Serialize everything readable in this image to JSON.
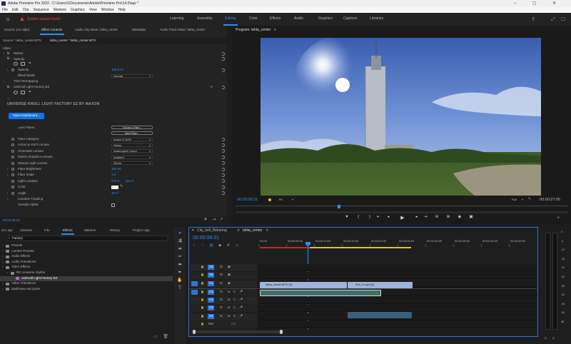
{
  "window": {
    "title": "Adobe Premiere Pro 2022 - C:\\Users\\1\\Documents\\Adobe\\Premiere Pro\\14.0\\aqv *",
    "minimize": "–",
    "maximize": "▢",
    "close": "✕"
  },
  "menu": [
    "File",
    "Edit",
    "Clip",
    "Sequence",
    "Markers",
    "Graphics",
    "View",
    "Window",
    "Help"
  ],
  "topbar": {
    "issues": "System issues found",
    "workspaces": [
      "Learning",
      "Assembly",
      "Editing",
      "Color",
      "Effects",
      "Audio",
      "Graphics",
      "Captions",
      "Libraries"
    ],
    "active": "Editing"
  },
  "source_tabs": [
    "Source: (no clips)",
    "Effect Controls",
    "Audio Clip Mixer: lahta_center",
    "Metadata",
    "Audio Track Mixer: lahta_center"
  ],
  "ec": {
    "source_label": "Source * lahta_center.MTS",
    "seq_label": "lahta_center * lahta_center.MTS",
    "video": "Video",
    "motion": "Motion",
    "opacity_group": "Opacity",
    "opacity_label": "Opacity",
    "opacity_value": "100.0 %",
    "blend_label": "Blend Mode",
    "blend_value": "Normal",
    "time_remap": "Time Remapping",
    "unknoll": "uniKnoll Light Factory EZ",
    "brand": "UNIVERSE KNOLL LIGHT FACTORY EZ BY MAXON",
    "dashboard": "Open Dashboard...",
    "lens_flares": "Lens Flares",
    "choose_flare": "Choose a Flare...",
    "save_flare": "Save Flare...",
    "params": [
      {
        "label": "Flare Category",
        "value": "Action & SciFi"
      },
      {
        "label": "Action & SciFi Lenses",
        "value": "Helios"
      },
      {
        "label": "Cinematic Lenses",
        "value": "Anamorphic Zoom"
      },
      {
        "label": "Motion Graphics Lenses",
        "value": "Ambient"
      },
      {
        "label": "Natural Light Lenses",
        "value": "35mm"
      }
    ],
    "brightness_label": "Flare Brightness",
    "brightness_value": "100.00",
    "scale_label": "Flare Scale",
    "scale_value": "1.0",
    "location_label": "Light Location",
    "location_x": "579.0",
    "location_y": "324.0",
    "color_label": "Color",
    "angle_label": "Angle",
    "angle_value": "40.0 °",
    "loc_tracking": "Location Tracking",
    "xrender": "Xrender Alpha",
    "timecode": "00:00:08:31"
  },
  "program": {
    "title": "Program: lahta_center",
    "timecode": "00:00:08:31",
    "fit": "Fit",
    "quality": "Full",
    "duration": "00:00:27:06"
  },
  "project": {
    "tabs": [
      "ect: aqv",
      "Libraries",
      "Info",
      "Effects",
      "Markers",
      "History",
      "Project: aqv"
    ],
    "active": "Effects",
    "search": "Factory",
    "tree": [
      {
        "label": "Presets",
        "depth": 0
      },
      {
        "label": "Lumetri Presets",
        "depth": 0
      },
      {
        "label": "Audio Effects",
        "depth": 0
      },
      {
        "label": "Audio Transitions",
        "depth": 0
      },
      {
        "label": "Video Effects",
        "depth": 0
      },
      {
        "label": "RG Universe Stylize",
        "depth": 1
      },
      {
        "label": "uniKnoll Light Factory EZ",
        "depth": 2
      },
      {
        "label": "Video Transitions",
        "depth": 0
      },
      {
        "label": "Шаблоны настроек",
        "depth": 0
      }
    ]
  },
  "timeline": {
    "tabs": [
      "City_hell_flickering",
      "lahta_center"
    ],
    "timecode": "00:00:08:31",
    "ruler": [
      "00:00",
      "00:00:05:00",
      "00:00:10:00",
      "00:00:15:00",
      "00:00:20:00",
      "00:00:25:00",
      "00:00:30:00",
      "00:00:35:00",
      "00:00:40:00",
      "00:00:45:00"
    ],
    "video_tracks": [
      "V3",
      "V2",
      "V1"
    ],
    "audio_tracks": [
      "A1",
      "A2",
      "A3",
      "A4"
    ],
    "mix": "Mix",
    "mix_value": "0.0",
    "clip_v1a": "lahta_center.MTS [V]",
    "clip_v1b": "003_0.mp4 [V]",
    "src_v": "V1",
    "src_a": "A1"
  },
  "audio_meter": {
    "labels": [
      "0",
      "-6",
      "-12",
      "-18",
      "-24",
      "-30",
      "-36",
      "-42",
      "-48",
      "-54",
      "dB"
    ],
    "solo": "S",
    "solo2": "S"
  }
}
